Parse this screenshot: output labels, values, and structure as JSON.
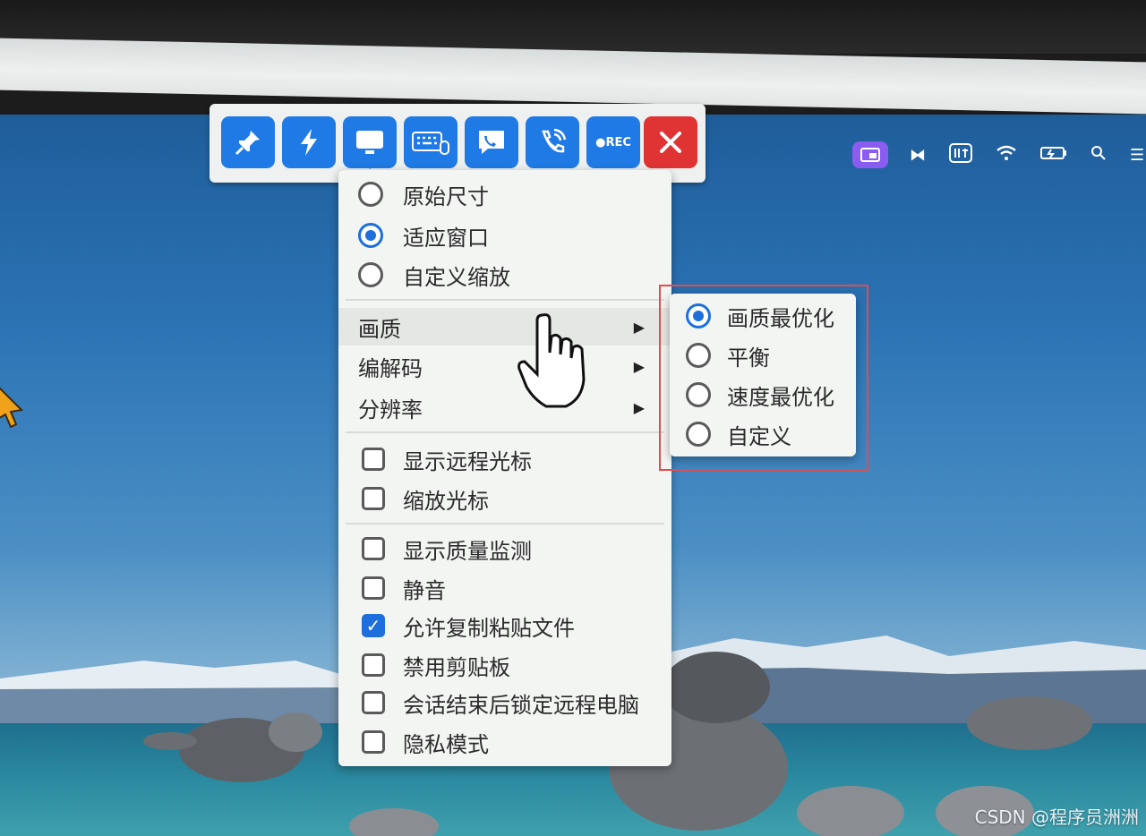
{
  "toolbar": {
    "buttons": [
      {
        "name": "pin-button",
        "icon": "pin-icon"
      },
      {
        "name": "lightning-button",
        "icon": "lightning-icon"
      },
      {
        "name": "display-button",
        "icon": "monitor-icon"
      },
      {
        "name": "keyboard-button",
        "icon": "keyboard-mouse-icon"
      },
      {
        "name": "chat-button",
        "icon": "phone-chat-icon"
      },
      {
        "name": "call-button",
        "icon": "phone-call-icon"
      },
      {
        "name": "record-button",
        "icon": "record-icon",
        "label": "●REC"
      },
      {
        "name": "close-button",
        "icon": "close-icon"
      }
    ],
    "accent": "#1f7ae6",
    "close_color": "#e03434"
  },
  "main_menu": {
    "scale_options": [
      {
        "label": "原始尺寸",
        "selected": false
      },
      {
        "label": "适应窗口",
        "selected": true
      },
      {
        "label": "自定义缩放",
        "selected": false
      }
    ],
    "submenus": [
      {
        "label": "画质"
      },
      {
        "label": "编解码"
      },
      {
        "label": "分辨率"
      }
    ],
    "cursor_options": [
      {
        "label": "显示远程光标",
        "checked": false
      },
      {
        "label": "缩放光标",
        "checked": false
      }
    ],
    "misc_options": [
      {
        "label": "显示质量监测",
        "checked": false
      },
      {
        "label": "静音",
        "checked": false
      },
      {
        "label": "允许复制粘贴文件",
        "checked": true
      },
      {
        "label": "禁用剪贴板",
        "checked": false
      },
      {
        "label": "会话结束后锁定远程电脑",
        "checked": false
      },
      {
        "label": "隐私模式",
        "checked": false
      }
    ]
  },
  "quality_submenu": {
    "options": [
      {
        "label": "画质最优化",
        "selected": true
      },
      {
        "label": "平衡",
        "selected": false
      },
      {
        "label": "速度最优化",
        "selected": false
      },
      {
        "label": "自定义",
        "selected": false
      }
    ],
    "highlight_color": "#e24c4c"
  },
  "watermark": "CSDN @程序员洲洲"
}
